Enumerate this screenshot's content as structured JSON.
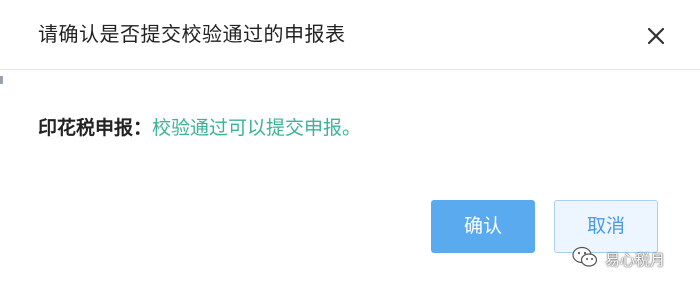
{
  "dialog": {
    "title": "请确认是否提交校验通过的申报表",
    "close_icon": "close-icon",
    "label": "印花税申报：",
    "message": "校验通过可以提交申报。",
    "confirm_label": "确认",
    "cancel_label": "取消"
  },
  "watermark": {
    "icon": "wechat-icon",
    "text": "易心税月"
  },
  "colors": {
    "message": "#3bb39a",
    "confirm_bg": "#5aaaf0",
    "cancel_bg": "#edf6fe",
    "cancel_text": "#4a9ae8"
  }
}
